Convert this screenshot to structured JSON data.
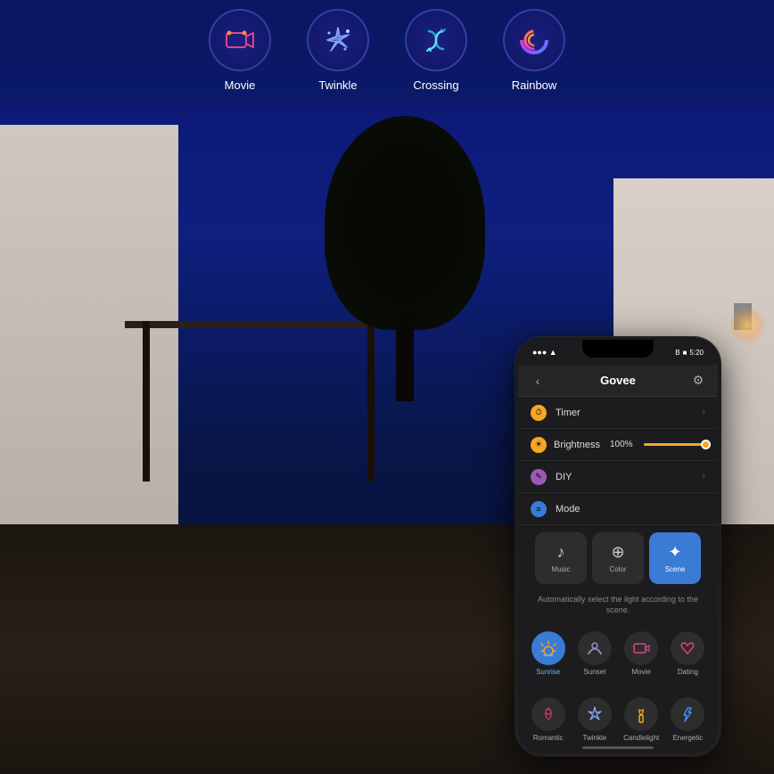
{
  "background": {
    "gradient_start": "#0a1060",
    "gradient_end": "#060e30"
  },
  "top_icons": {
    "items": [
      {
        "id": "movie",
        "label": "Movie",
        "emoji": "🎬",
        "color_gradient": "from #e04488 to #cc3377"
      },
      {
        "id": "twinkle",
        "label": "Twinkle",
        "emoji": "✦",
        "color_gradient": "from #88aaff to #aaddff"
      },
      {
        "id": "crossing",
        "label": "Crossing",
        "emoji": "∞",
        "color_gradient": "from #22aacc to #66ddff"
      },
      {
        "id": "rainbow",
        "label": "Rainbow",
        "emoji": "◎",
        "color_gradient": "from #ff4488 to #8844ff"
      }
    ]
  },
  "phone": {
    "status_bar": {
      "time": "5:20",
      "signal": "●●●",
      "wifi": "▲",
      "battery": "■"
    },
    "nav": {
      "title": "Govee",
      "back_icon": "‹",
      "settings_icon": "⚙"
    },
    "menu_items": [
      {
        "id": "timer",
        "icon": "⏱",
        "icon_bg": "#f5a623",
        "label": "Timer",
        "has_chevron": true
      },
      {
        "id": "diy",
        "icon": "✎",
        "icon_bg": "#9b59b6",
        "label": "DIY",
        "has_chevron": true
      },
      {
        "id": "mode",
        "icon": "≡",
        "icon_bg": "#3a7bd5",
        "label": "Mode",
        "has_chevron": false
      }
    ],
    "brightness": {
      "label": "Brightness",
      "value": "100%",
      "percent": 100,
      "icon": "☀",
      "icon_bg": "#f5a623"
    },
    "mode_tabs": [
      {
        "id": "music",
        "label": "Music",
        "icon": "♪",
        "active": false
      },
      {
        "id": "color",
        "label": "Color",
        "icon": "⊕",
        "active": false
      },
      {
        "id": "scene",
        "label": "Scene",
        "icon": "✦",
        "active": true
      }
    ],
    "scene_description": "Automatically select the light according to the scene.",
    "scenes_row1": [
      {
        "id": "sunrise",
        "label": "Sunrise",
        "icon": "🌅",
        "active": true
      },
      {
        "id": "sunset",
        "label": "Sunset",
        "icon": "🌙",
        "active": false
      },
      {
        "id": "movie",
        "label": "Movie",
        "icon": "🎬",
        "active": false
      },
      {
        "id": "dating",
        "label": "Dating",
        "icon": "❤",
        "active": false
      }
    ],
    "scenes_row2": [
      {
        "id": "romantic",
        "label": "Romantic",
        "icon": "🌹",
        "active": false
      },
      {
        "id": "twinkle",
        "label": "Twinkle",
        "icon": "✦",
        "active": false
      },
      {
        "id": "candlelight",
        "label": "Candlelight",
        "icon": "🕯",
        "active": false
      },
      {
        "id": "energetic",
        "label": "Energetic",
        "icon": "💧",
        "active": false
      }
    ]
  }
}
